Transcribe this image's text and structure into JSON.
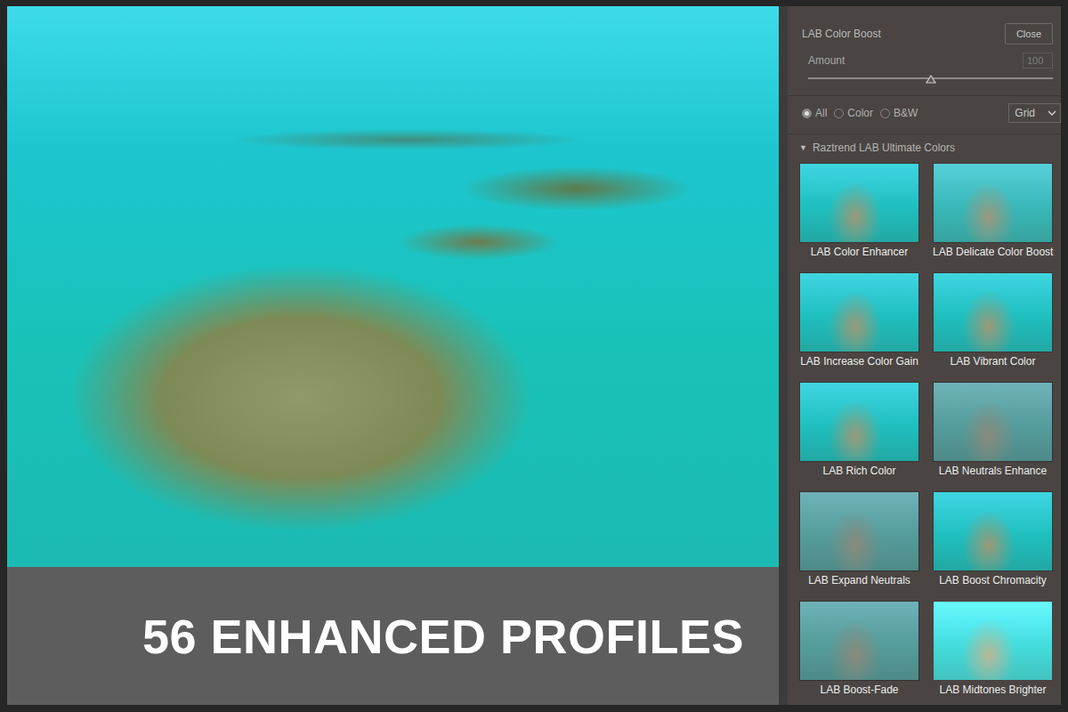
{
  "caption": "56 ENHANCED PROFILES",
  "panel": {
    "title": "LAB Color Boost",
    "close_button": "Close",
    "amount": {
      "label": "Amount",
      "value": "100",
      "level": 0.5
    },
    "filters": [
      {
        "label": "All",
        "selected": true
      },
      {
        "label": "Color",
        "selected": false
      },
      {
        "label": "B&W",
        "selected": false
      }
    ],
    "view": {
      "value": "Grid"
    },
    "group": {
      "icon": "▼",
      "label": "Raztrend LAB Ultimate Colors",
      "expanded": true
    },
    "profiles": [
      {
        "label": "LAB Color Enhancer"
      },
      {
        "label": "LAB Delicate Color Boost"
      },
      {
        "label": "LAB Increase Color Gain"
      },
      {
        "label": "LAB Vibrant Color"
      },
      {
        "label": "LAB Rich Color"
      },
      {
        "label": "LAB Neutrals Enhance"
      },
      {
        "label": "LAB Expand Neutrals"
      },
      {
        "label": "LAB Boost Chromacity"
      },
      {
        "label": "LAB Boost-Fade"
      },
      {
        "label": "LAB Midtones Brighter"
      }
    ]
  }
}
